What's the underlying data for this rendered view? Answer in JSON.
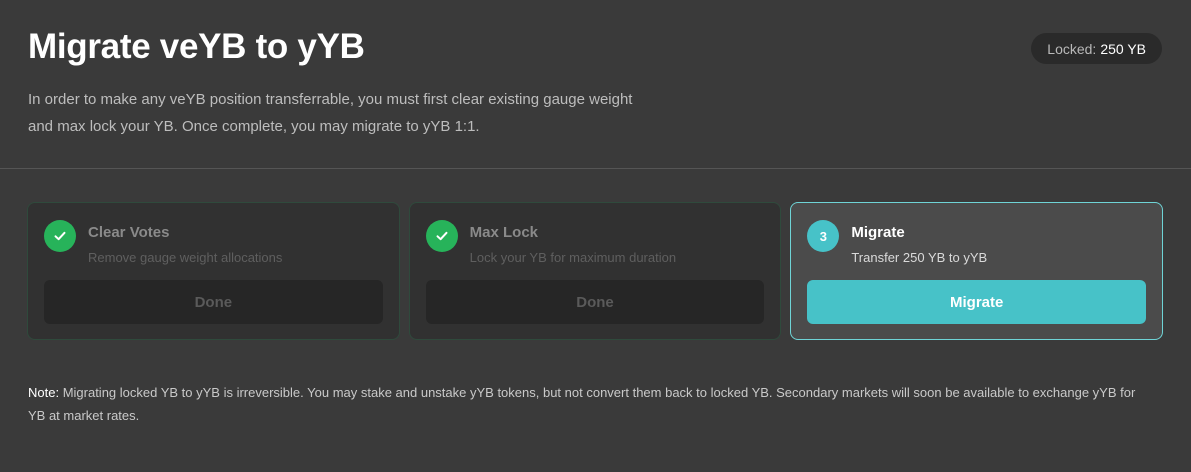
{
  "header": {
    "title": "Migrate veYB to yYB",
    "description": "In order to make any veYB position transferrable, you must first clear existing gauge weight and max lock your YB. Once complete, you may migrate to yYB 1:1.",
    "locked_label": "Locked:",
    "locked_value": "250 YB"
  },
  "steps": [
    {
      "status": "done",
      "icon": "check-icon",
      "title": "Clear Votes",
      "subtitle": "Remove gauge weight allocations",
      "button": "Done"
    },
    {
      "status": "done",
      "icon": "check-icon",
      "title": "Max Lock",
      "subtitle": "Lock your YB for maximum duration",
      "button": "Done"
    },
    {
      "status": "active",
      "number": "3",
      "title": "Migrate",
      "subtitle": "Transfer 250 YB to yYB",
      "button": "Migrate"
    }
  ],
  "note": {
    "label": "Note:",
    "text": " Migrating locked YB to yYB is irreversible. You may stake and unstake yYB tokens, but not convert them back to locked YB. Secondary markets will soon be available to exchange yYB for YB at market rates."
  },
  "colors": {
    "background": "#3a3a3a",
    "accent": "#47c2c8",
    "success": "#27b35a"
  }
}
